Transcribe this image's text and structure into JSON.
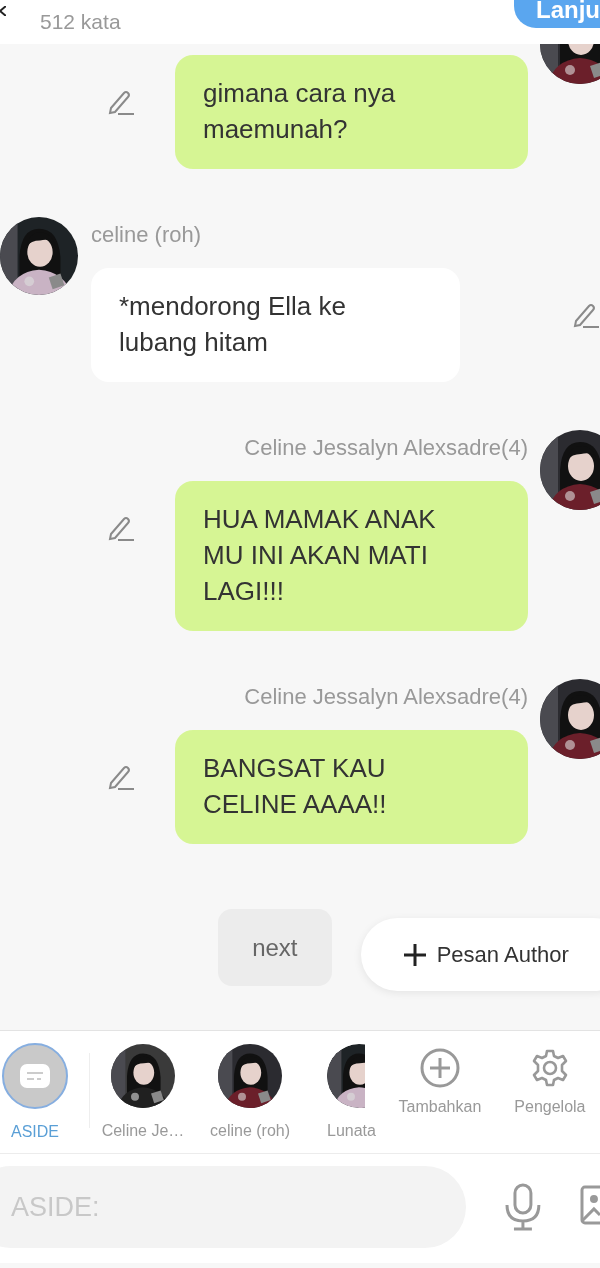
{
  "header": {
    "word_count": "512 kata",
    "continue_button": "Lanju"
  },
  "messages": [
    {
      "kind": "sent",
      "text": "gimana cara nya maemunah?"
    },
    {
      "kind": "received",
      "name": "celine (roh)",
      "text": "*mendorong Ella ke lubang hitam"
    },
    {
      "kind": "sent",
      "name": "Celine Jessalyn Alexsadre(4)",
      "text": "HUA MAMAK ANAK MU INI AKAN MATI LAGI!!!"
    },
    {
      "kind": "sent",
      "name": "Celine Jessalyn Alexsadre(4)",
      "text": "BANGSAT KAU CELINE AAAA!!"
    }
  ],
  "actions": {
    "next": "next",
    "add_author": "Pesan Author"
  },
  "characters": [
    {
      "kind": "aside",
      "label": "ASIDE",
      "selected": true
    },
    {
      "kind": "avatar",
      "label": "Celine Je…",
      "selected": false
    },
    {
      "kind": "avatar",
      "label": "celine (roh)",
      "selected": false
    },
    {
      "kind": "avatar",
      "label": "Lunata",
      "selected": false
    },
    {
      "kind": "add",
      "label": "Tambahkan",
      "selected": false
    },
    {
      "kind": "settings",
      "label": "Pengelola",
      "selected": false
    }
  ],
  "input": {
    "placeholder": "ASIDE:"
  }
}
